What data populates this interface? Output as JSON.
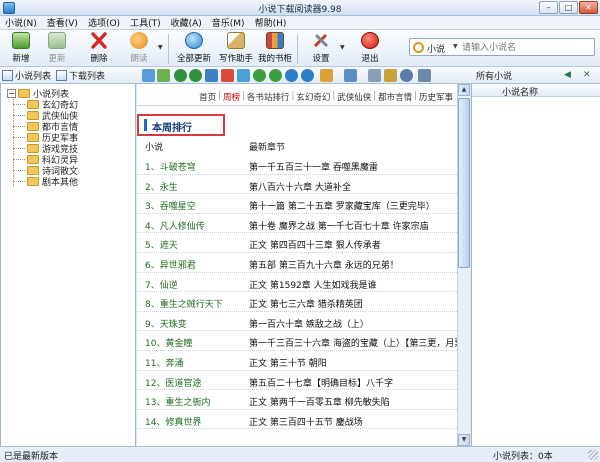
{
  "window": {
    "title": "小说下载阅读器9.98",
    "min": "–",
    "max": "□",
    "close": "✕"
  },
  "menu": [
    "小说(N)",
    "查看(V)",
    "选项(O)",
    "工具(T)",
    "收藏(A)",
    "音乐(M)",
    "帮助(H)"
  ],
  "toolbar": {
    "new": "新增",
    "update": "更新",
    "delete": "删除",
    "reading": "朗读",
    "update_all": "全部更新",
    "writing_helper": "写作助手",
    "my_bookshelf": "我的书柜",
    "settings": "设置",
    "exit": "退出",
    "search_scope": "小说",
    "search_placeholder": "请输入小说名"
  },
  "left_panel": {
    "tab_novel_list": "小说列表",
    "tab_download_list": "下载列表",
    "root": "小说列表",
    "categories": [
      "玄幻奇幻",
      "武侠仙侠",
      "都市言情",
      "历史军事",
      "游戏竞技",
      "科幻灵异",
      "诗词散文",
      "剧本其他"
    ]
  },
  "center": {
    "crumbs": [
      "首页",
      "周榜",
      "各书站排行",
      "玄幻奇幻",
      "武侠仙侠",
      "都市言情",
      "历史军事"
    ],
    "active_crumb": "周榜",
    "section_title": "本周排行",
    "columns": {
      "novel": "小说",
      "latest_chapter": "最新章节"
    },
    "rows": [
      {
        "name": "1、斗破苍穹",
        "chapter": "第一千五百三十一章  吞噬黑魔雷"
      },
      {
        "name": "2、永生",
        "chapter": "第八百六十六章  大道补全"
      },
      {
        "name": "3、吞噬星空",
        "chapter": "第十一篇  第二十五章  罗家藏宝库（三更完毕）"
      },
      {
        "name": "4、凡人修仙传",
        "chapter": "第十卷  魔界之战  第一千七百七十章  许家宗庙"
      },
      {
        "name": "5、遮天",
        "chapter": "正文  第四百四十三章  狠人传承者"
      },
      {
        "name": "6、异世邪君",
        "chapter": "第五部  第三百九十六章  永远的兄弟！"
      },
      {
        "name": "7、仙逆",
        "chapter": "正文  第1592章  人生如戏我是谁"
      },
      {
        "name": "8、重生之贼行天下",
        "chapter": "正文  第七三六章  猎杀精英团"
      },
      {
        "name": "9、天珠变",
        "chapter": "第一百六十章  嫉敌之战（上）"
      },
      {
        "name": "10、黄金瞳",
        "chapter": "第一千三百三十六章  海盗的宝藏（上）【第三更，月票！】"
      },
      {
        "name": "11、奔涌",
        "chapter": "正文  第三十节  朝阳"
      },
      {
        "name": "12、医道官途",
        "chapter": "第五百二十七章【明确目标】八千字"
      },
      {
        "name": "13、重生之衙内",
        "chapter": "正文  第两千一百零五章  柳先敏失陷"
      },
      {
        "name": "14、修真世界",
        "chapter": "正文  第三百四十五节  鏖战场"
      }
    ]
  },
  "right_panel": {
    "title": "所有小说",
    "column": "小说名称"
  },
  "status": {
    "left": "已是最新版本",
    "right": "小说列表：0本"
  }
}
